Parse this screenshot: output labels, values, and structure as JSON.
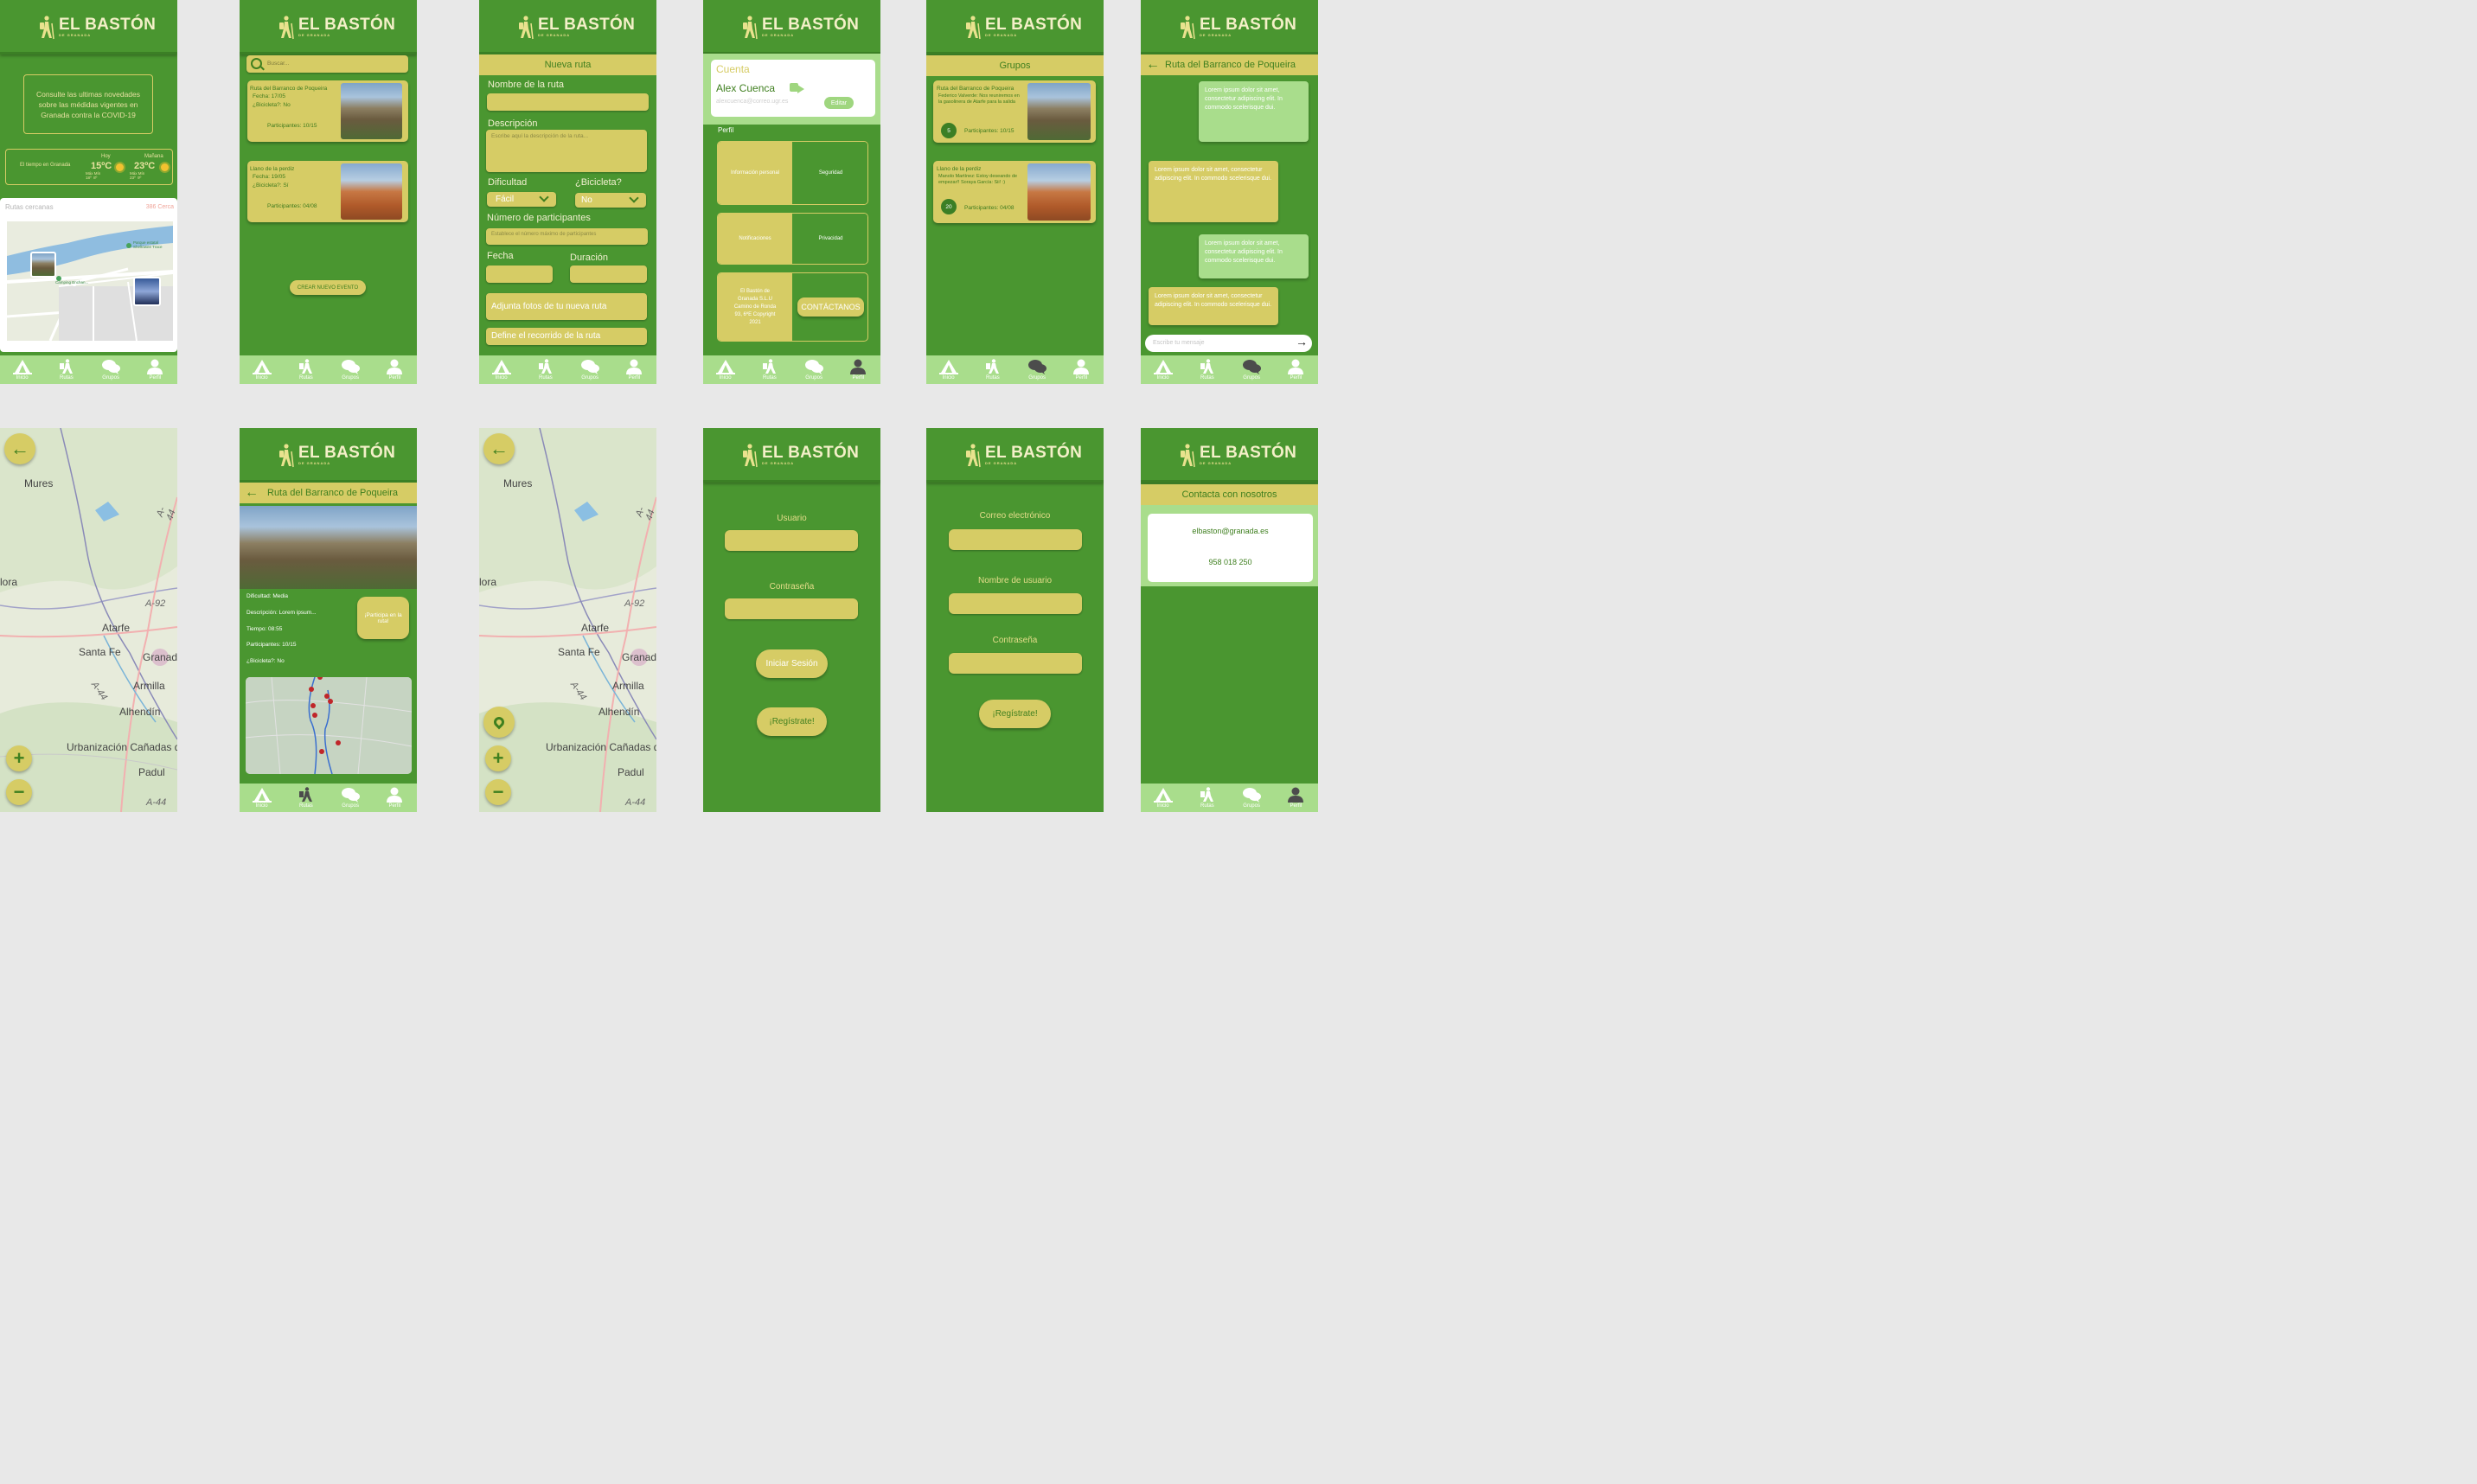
{
  "brand": {
    "name": "EL BASTÓN",
    "sub": "DE GRANADA"
  },
  "nav": {
    "inicio": "Inicio",
    "rutas": "Rutas",
    "grupos": "Grupos",
    "perfil": "Perfil"
  },
  "home": {
    "covid": "Consulte las ultimas novedades sobre las médidas vigentes en Granada contra la COVID-19",
    "weather_label": "El tiempo en Granada",
    "today": "Hoy",
    "today_temp": "15ºC",
    "today_mm": "Máx Mín\n18º  8º",
    "tomorrow": "Mañana",
    "tomorrow_temp": "23ºC",
    "tomorrow_mm": "Máx Mín\n23º  9º",
    "nearby": "Rutas cercanas",
    "nearby_dist": "386 Cerca",
    "map_labels": [
      "Parque estatal Sheltowee Trace",
      "Camping Enchan..."
    ]
  },
  "search": {
    "placeholder": "Buscar...",
    "events": [
      {
        "title": "Ruta del Barranco de Poqueira",
        "date": "Fecha: 17/05",
        "bike": "¿Bicicleta?: No",
        "participants": "Participantes: 10/15"
      },
      {
        "title": "Llano de la perdiz",
        "date": "Fecha: 19/05",
        "bike": "¿Bicicleta?: Sí",
        "participants": "Participantes: 04/08"
      }
    ],
    "create": "CREAR NUEVO EVENTO"
  },
  "newroute": {
    "title": "Nueva ruta",
    "name_label": "Nombre de la ruta",
    "desc_label": "Descripción",
    "desc_ph": "Escribe aquí la descripción de la ruta...",
    "diff_label": "Dificultad",
    "diff_val": "Fácil",
    "bike_label": "¿Bicicleta?",
    "bike_val": "No",
    "num_label": "Número de participantes",
    "num_ph": "Establece el número máximo de participantes",
    "date_label": "Fecha",
    "dur_label": "Duración",
    "photos": "Adjunta fotos de tu nueva ruta",
    "path": "Define el recorrido de la ruta"
  },
  "profile": {
    "cuenta": "Cuenta",
    "user": "Alex Cuenca",
    "email": "alexcuenca@correo.ugr.es",
    "edit": "Editar",
    "perfil": "Perfil",
    "info": "Información personal",
    "seg": "Seguridad",
    "notif": "Notificaciones",
    "priv": "Privacidad",
    "company": "El Bastón de Granada S.L.U Camino de Ronda 93, 6ºE Copyright 2021",
    "contact": "CONTÁCTANOS"
  },
  "groups": {
    "title": "Grupos",
    "items": [
      {
        "title": "Ruta del Barranco de Poqueira",
        "msg": "Federico Valverde: Nos reuniremos en la gasolinera de Atarfe para la salida",
        "badge": "5",
        "participants": "Participantes: 10/15"
      },
      {
        "title": "Llano de la perdiz",
        "msg": "Manolo Martínez: Estoy deseando de empezar!! Soraya García: Sii! :)",
        "badge": "20",
        "participants": "Participantes: 04/08"
      }
    ]
  },
  "chat": {
    "title": "Ruta del Barranco de Poqueira",
    "msg": "Lorem ipsum dolor sit amet, consectetur adipiscing elit. In commodo scelerisque dui.",
    "placeholder": "Escribe tu mensaje"
  },
  "maps": {
    "labels": [
      "Mures",
      "lora",
      "Atarfe",
      "Santa Fe",
      "Granada",
      "Armilla",
      "Alhendín",
      "Urbanización Cañadas d",
      "Padul",
      "A-92",
      "A-44",
      "A-44",
      "A-44"
    ]
  },
  "detail": {
    "title": "Ruta del Barranco de Poqueira",
    "diff": "Dificultad: Media",
    "desc": "Descripción: Lorem ipsum...",
    "time": "Tiempo: 08:55",
    "participants": "Participantes: 10/15",
    "bike": "¿Bicicleta?: No",
    "join": "¡Participa en la ruta!"
  },
  "login": {
    "user": "Usuario",
    "pass": "Contraseña",
    "login": "Iniciar Sesión",
    "register": "¡Regístrate!"
  },
  "register": {
    "email": "Correo electrónico",
    "user": "Nombre de usuario",
    "pass": "Contraseña",
    "register": "¡Regístrate!"
  },
  "contact": {
    "title": "Contacta con nosotros",
    "email": "elbaston@granada.es",
    "phone": "958 018 250"
  },
  "colors": {
    "green": "#4a9630",
    "yellow": "#d6cc65",
    "light": "#a9dd8c"
  }
}
